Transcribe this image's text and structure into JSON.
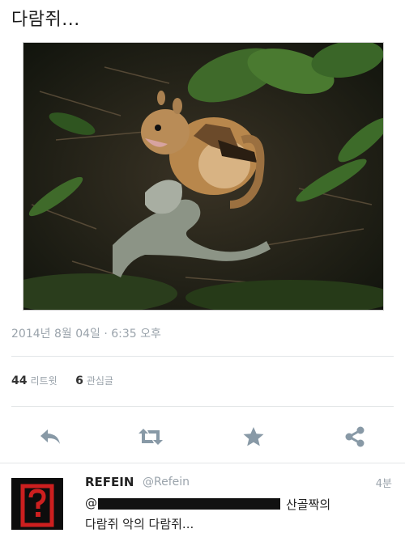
{
  "tweet": {
    "text": "다람쥐...",
    "timestamp": "2014년 8월 04일 · 6:35 오후"
  },
  "stats": {
    "retweets_count": "44",
    "retweets_label": "리트윗",
    "favorites_count": "6",
    "favorites_label": "관심글"
  },
  "actions": [
    "reply-icon",
    "retweet-icon",
    "star-icon",
    "share-icon"
  ],
  "colors": {
    "icon": "#8899a6",
    "muted_text": "#9aa3ab",
    "avatar_red": "#cc1f1f"
  },
  "reply": {
    "name": "REFEIN",
    "handle": "@Refein",
    "time": "4분",
    "mention_prefix": "@",
    "line1_tail": "산골짝의",
    "line2": "다람쥐 악의 다람쥐..."
  }
}
